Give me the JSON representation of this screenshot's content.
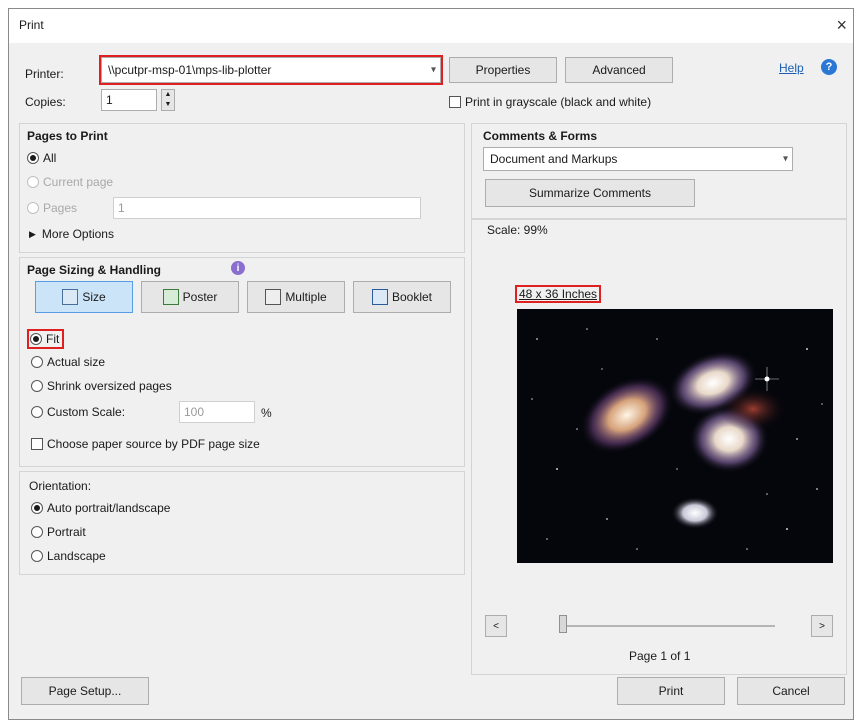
{
  "window": {
    "title": "Print",
    "close_glyph": "×"
  },
  "printer": {
    "label": "Printer:",
    "value": "\\\\pcutpr-msp-01\\mps-lib-plotter",
    "properties": "Properties",
    "advanced": "Advanced",
    "help": "Help"
  },
  "copies": {
    "label": "Copies:",
    "value": "1"
  },
  "grayscale": {
    "label": "Print in grayscale (black and white)",
    "checked": false
  },
  "pages_to_print": {
    "heading": "Pages to Print",
    "all": "All",
    "current_page": "Current page",
    "pages": "Pages",
    "pages_value": "1",
    "more_options": "More Options"
  },
  "sizing": {
    "heading": "Page Sizing & Handling",
    "buttons": [
      "Size",
      "Poster",
      "Multiple",
      "Booklet"
    ],
    "fit": "Fit",
    "actual_size": "Actual size",
    "shrink": "Shrink oversized pages",
    "custom_scale": "Custom Scale:",
    "custom_scale_value": "100",
    "percent": "%",
    "paper_source": "Choose paper source by PDF page size"
  },
  "orientation": {
    "heading": "Orientation:",
    "auto": "Auto portrait/landscape",
    "portrait": "Portrait",
    "landscape": "Landscape"
  },
  "comments_forms": {
    "heading": "Comments & Forms",
    "value": "Document and Markups",
    "summarize": "Summarize Comments"
  },
  "preview": {
    "scale": "Scale: 99%",
    "paper_size": "48 x 36 Inches",
    "prev": "<",
    "next": ">",
    "page_status": "Page 1 of 1"
  },
  "footer": {
    "page_setup": "Page Setup...",
    "print": "Print",
    "cancel": "Cancel"
  },
  "colors": {
    "highlight": "#e02020",
    "link": "#1a5fb4",
    "help_icon": "#2a78d4"
  }
}
